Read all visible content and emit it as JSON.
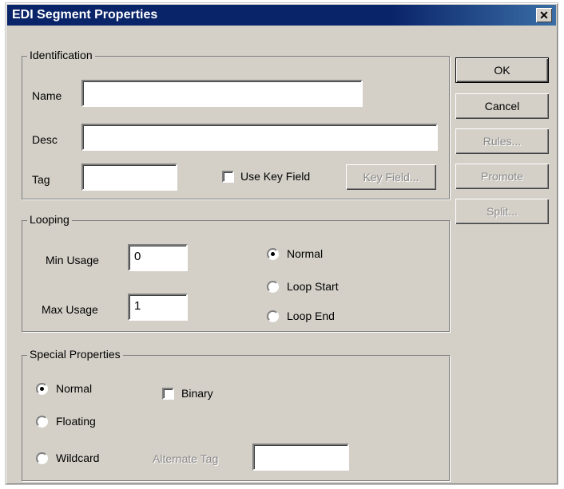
{
  "window": {
    "title": "EDI Segment Properties",
    "close_glyph": "✕"
  },
  "buttons": {
    "ok": "OK",
    "cancel": "Cancel",
    "rules": "Rules...",
    "promote": "Promote",
    "split": "Split..."
  },
  "identification": {
    "legend": "Identification",
    "name_label": "Name",
    "name_value": "",
    "desc_label": "Desc",
    "desc_value": "",
    "tag_label": "Tag",
    "tag_value": "",
    "use_key_field_label": "Use Key Field",
    "use_key_field_checked": false,
    "key_field_button": "Key Field..."
  },
  "looping": {
    "legend": "Looping",
    "min_usage_label": "Min Usage",
    "min_usage_value": "0",
    "max_usage_label": "Max Usage",
    "max_usage_value": "1",
    "options": [
      "Normal",
      "Loop Start",
      "Loop End"
    ],
    "selected": "Normal"
  },
  "special": {
    "legend": "Special Properties",
    "options": [
      "Normal",
      "Floating",
      "Wildcard"
    ],
    "selected": "Normal",
    "binary_label": "Binary",
    "binary_checked": false,
    "alternate_tag_label": "Alternate Tag",
    "alternate_tag_value": ""
  },
  "colors": {
    "titlebar": "#0a246a",
    "face": "#d4d0c8",
    "disabled_text": "#8a8a8a"
  }
}
